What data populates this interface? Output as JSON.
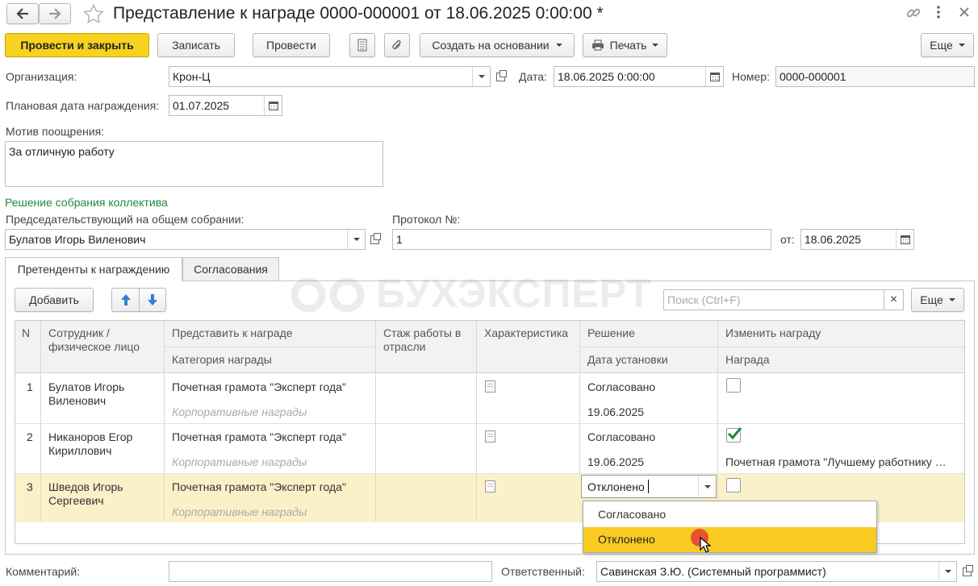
{
  "window": {
    "title": "Представление к награде 0000-000001 от 18.06.2025 0:00:00 *",
    "icons": [
      "back-arrow-icon",
      "forward-arrow-icon",
      "star-icon",
      "link-icon",
      "more-vertical-icon",
      "close-icon"
    ]
  },
  "toolbar": {
    "post_and_close": "Провести и закрыть",
    "save": "Записать",
    "post": "Провести",
    "create_based_on": "Создать на основании",
    "print": "Печать",
    "more": "Еще"
  },
  "header": {
    "org_label": "Организация:",
    "org_value": "Крон-Ц",
    "date_label": "Дата:",
    "date_value": "18.06.2025  0:00:00",
    "number_label": "Номер:",
    "number_value": "0000-000001",
    "plan_date_label": "Плановая дата награждения:",
    "plan_date_value": "01.07.2025",
    "motive_label": "Мотив поощрения:",
    "motive_value": "За отличную работу"
  },
  "meeting": {
    "section_title": "Решение собрания коллектива",
    "chair_label": "Председательствующий на общем собрании:",
    "chair_value": "Булатов Игорь Виленович",
    "protocol_label": "Протокол №:",
    "protocol_value": "1",
    "from_label": "от:",
    "from_value": "18.06.2025"
  },
  "tabs": [
    {
      "label": "Претенденты к награждению",
      "active": true
    },
    {
      "label": "Согласования",
      "active": false
    }
  ],
  "table_toolbar": {
    "add": "Добавить",
    "search_placeholder": "Поиск (Ctrl+F)",
    "clear": "×",
    "more": "Еще"
  },
  "table": {
    "headers": {
      "n": "N",
      "employee": "Сотрудник / физическое лицо",
      "award": "Представить к награде",
      "award_category": "Категория награды",
      "experience": "Стаж работы в отрасли",
      "characteristic": "Характеристика",
      "decision": "Решение",
      "decision_date": "Дата установки",
      "change_award": "Изменить награду",
      "new_award": "Награда"
    },
    "rows": [
      {
        "n": "1",
        "employee": "Булатов Игорь Виленович",
        "award": "Почетная грамота \"Эксперт года\"",
        "category": "Корпоративные награды",
        "decision": "Согласовано",
        "decision_date": "19.06.2025",
        "change_checked": false,
        "new_award": ""
      },
      {
        "n": "2",
        "employee": "Никаноров Егор Кириллович",
        "award": "Почетная грамота \"Эксперт года\"",
        "category": "Корпоративные награды",
        "decision": "Согласовано",
        "decision_date": "19.06.2025",
        "change_checked": true,
        "new_award": "Почетная грамота \"Лучшему работнику …"
      },
      {
        "n": "3",
        "employee": "Шведов Игорь Сергеевич",
        "award": "Почетная грамота \"Эксперт года\"",
        "category": "Корпоративные награды",
        "decision": "Отклонено",
        "decision_date": "",
        "change_checked": false,
        "new_award": ""
      }
    ]
  },
  "dropdown": {
    "options": [
      "Согласовано",
      "Отклонено"
    ],
    "highlighted": "Отклонено"
  },
  "watermark": "БУХЭКСПЕРТ",
  "footer": {
    "comment_label": "Комментарий:",
    "comment_value": "",
    "responsible_label": "Ответственный:",
    "responsible_value": "Савинская З.Ю. (Системный программист)"
  },
  "colors": {
    "primary_button": "#f7d21f",
    "section_title": "#1f8a3a",
    "selected_row": "#fbf1c8",
    "dropdown_highlight": "#f7cb22",
    "checkmark": "#1e8a3a"
  }
}
